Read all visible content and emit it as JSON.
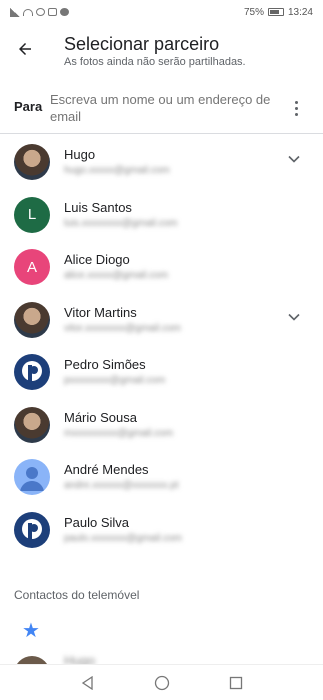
{
  "status": {
    "battery": "75%",
    "time": "13:24",
    "battery_level": 0.75
  },
  "header": {
    "title": "Selecionar parceiro",
    "subtitle": "As fotos ainda não serão partilhadas."
  },
  "to_field": {
    "label": "Para",
    "placeholder": "Escreva um nome ou um endereço de email"
  },
  "contacts": [
    {
      "name": "Hugo",
      "email": "hugo.xxxxx@gmail.com",
      "avatar": "photo",
      "expandable": true
    },
    {
      "name": "Luis Santos",
      "email": "luis.xxxxxxxx@gmail.com",
      "avatar": "letter",
      "letter": "L",
      "color": "#1e6b45",
      "expandable": false
    },
    {
      "name": "Alice Diogo",
      "email": "alice.xxxxx@gmail.com",
      "avatar": "letter",
      "letter": "A",
      "color": "#e8457a",
      "expandable": false
    },
    {
      "name": "Vitor Martins",
      "email": "vitor.xxxxxxxx@gmail.com",
      "avatar": "photo",
      "expandable": true
    },
    {
      "name": "Pedro Simões",
      "email": "pxxxxxxxx@gmail.com",
      "avatar": "logo",
      "expandable": false
    },
    {
      "name": "Mário Sousa",
      "email": "mxxxxxxxxx@gmail.com",
      "avatar": "photo",
      "expandable": false
    },
    {
      "name": "André Mendes",
      "email": "andre.xxxxxx@xxxxxxx.pt",
      "avatar": "placeholder",
      "expandable": false
    },
    {
      "name": "Paulo Silva",
      "email": "paulo.xxxxxxx@gmail.com",
      "avatar": "logo",
      "expandable": false
    }
  ],
  "section": {
    "title": "Contactos do telemóvel"
  },
  "partial_contact": {
    "name": "Hugo"
  },
  "icons": {
    "back": "arrow-left-icon",
    "menu": "more-vert-icon",
    "expand": "chevron-down-icon",
    "star": "star-icon",
    "nav_back": "triangle-back-icon",
    "nav_home": "circle-home-icon",
    "nav_recents": "square-recents-icon"
  },
  "colors": {
    "star": "#4285f4",
    "divider": "#dadce0"
  }
}
